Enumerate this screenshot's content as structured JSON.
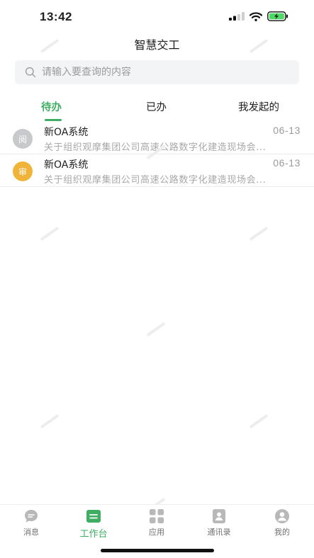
{
  "status_bar": {
    "time": "13:42"
  },
  "header": {
    "title": "智慧交工"
  },
  "search": {
    "placeholder": "请输入要查询的内容"
  },
  "tabs": [
    {
      "label": "待办",
      "active": true
    },
    {
      "label": "已办",
      "active": false
    },
    {
      "label": "我发起的",
      "active": false
    }
  ],
  "list": [
    {
      "badge": "阅",
      "badge_color": "#c8c9cc",
      "title": "新OA系统",
      "date": "06-13",
      "desc": "关于组织观摩集团公司高速公路数字化建造现场会..."
    },
    {
      "badge": "审",
      "badge_color": "#f0b43a",
      "title": "新OA系统",
      "date": "06-13",
      "desc": "关于组织观摩集团公司高速公路数字化建造现场会..."
    }
  ],
  "bottom_nav": [
    {
      "label": "消息",
      "icon": "chat-bubble-icon",
      "active": false
    },
    {
      "label": "工作台",
      "icon": "workbench-icon",
      "active": true
    },
    {
      "label": "应用",
      "icon": "apps-grid-icon",
      "active": false
    },
    {
      "label": "通讯录",
      "icon": "contacts-icon",
      "active": false
    },
    {
      "label": "我的",
      "icon": "profile-icon",
      "active": false
    }
  ],
  "colors": {
    "accent": "#3fae63",
    "read_badge": "#c8c9cc",
    "review_badge": "#f0b43a"
  }
}
